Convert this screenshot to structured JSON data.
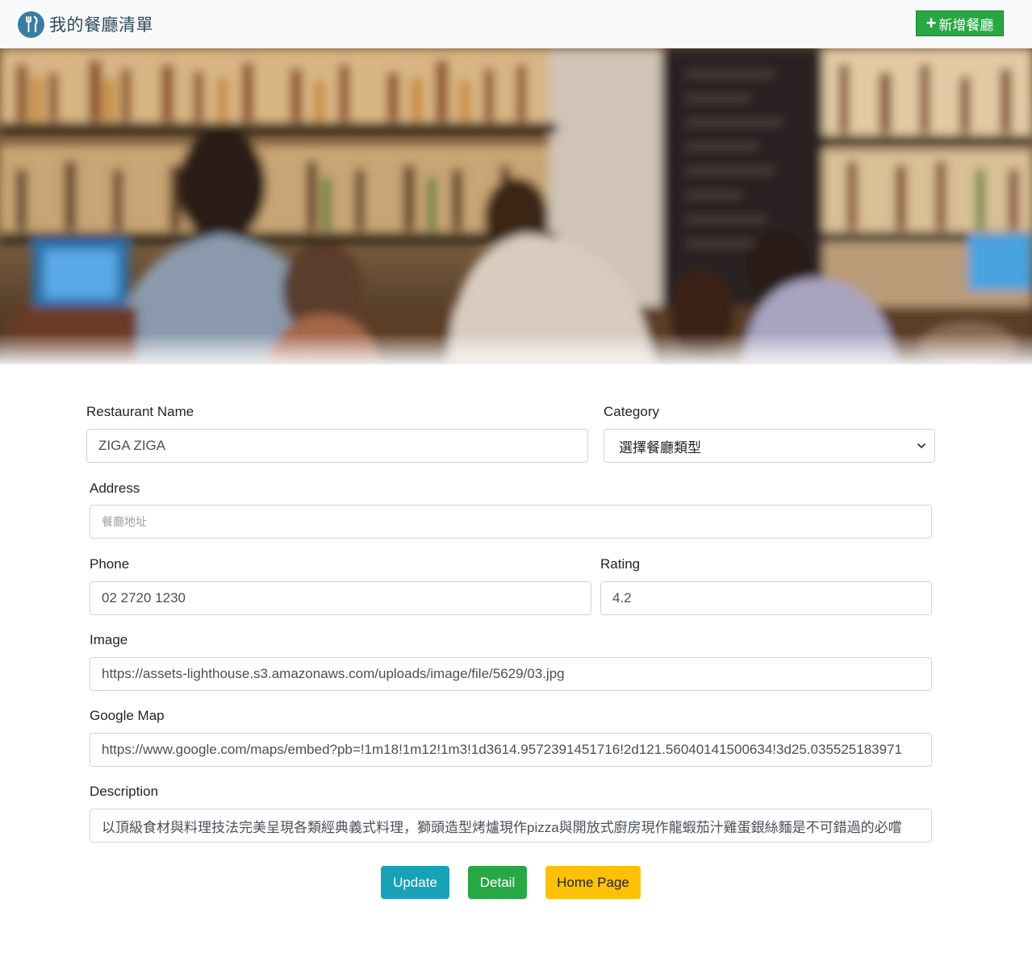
{
  "navbar": {
    "brand_title": "我的餐廳清單",
    "brand_icon": "utensils-icon",
    "add_button_label": "新增餐廳",
    "add_button_icon": "plus-icon"
  },
  "form": {
    "restaurant_name": {
      "label": "Restaurant Name",
      "value": "ZIGA ZIGA"
    },
    "category": {
      "label": "Category",
      "selected": "選擇餐廳類型"
    },
    "address": {
      "label": "Address",
      "placeholder": "餐廳地址",
      "value": ""
    },
    "phone": {
      "label": "Phone",
      "value": "02 2720 1230"
    },
    "rating": {
      "label": "Rating",
      "value": "4.2"
    },
    "image": {
      "label": "Image",
      "value": "https://assets-lighthouse.s3.amazonaws.com/uploads/image/file/5629/03.jpg"
    },
    "google_map": {
      "label": "Google Map",
      "value": "https://www.google.com/maps/embed?pb=!1m18!1m12!1m3!1d3614.9572391451716!2d121.56040141500634!3d25.035525183971"
    },
    "description": {
      "label": "Description",
      "value": "以頂級食材與料理技法完美呈現各類經典義式料理，獅頭造型烤爐現作pizza與開放式廚房現作龍蝦茄汁雞蛋銀絲麵是不可錯過的必嚐"
    }
  },
  "actions": {
    "update_label": "Update",
    "detail_label": "Detail",
    "home_label": "Home Page"
  },
  "colors": {
    "navbar_bg": "#f8f9fa",
    "brand_blue": "#3a7ca5",
    "success": "#28a745",
    "info": "#17a2b8",
    "warning": "#ffc107"
  }
}
